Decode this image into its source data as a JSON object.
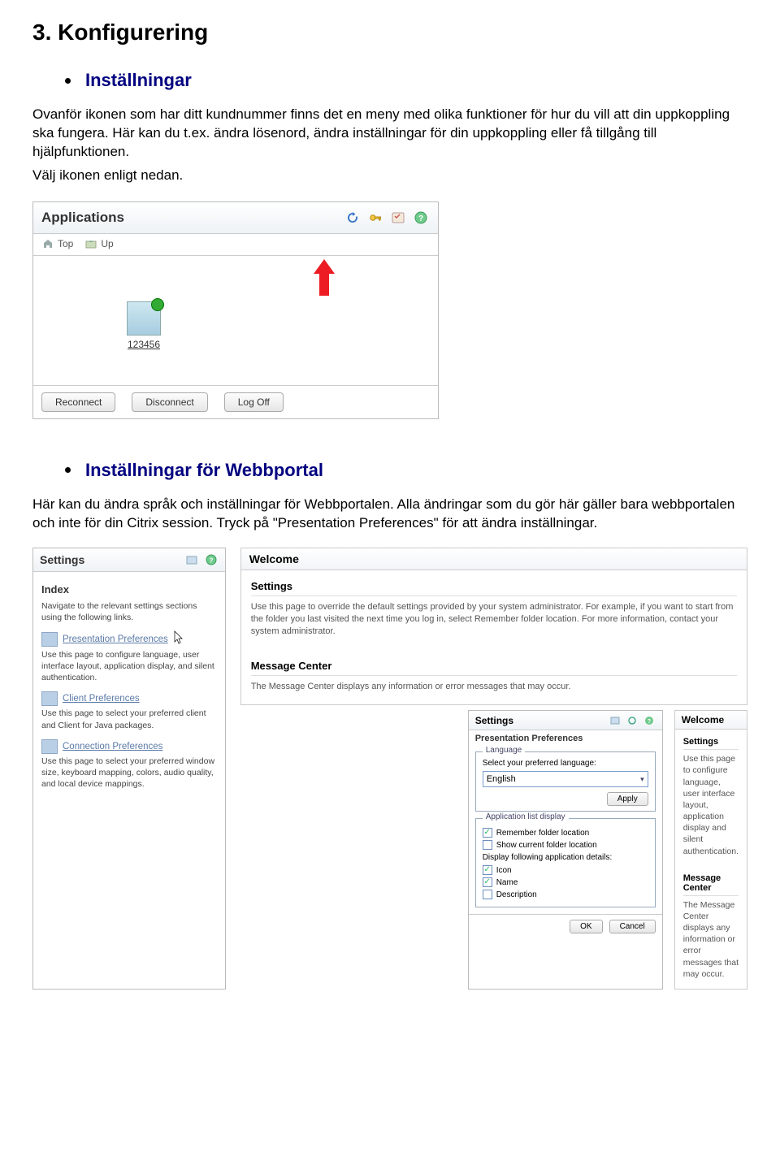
{
  "doc": {
    "heading": "3. Konfigurering",
    "bullet1": "Inställningar",
    "para1": "Ovanför ikonen som har ditt kundnummer finns det en meny med olika funktioner för hur du vill att din uppkoppling ska fungera. Här kan du t.ex. ändra lösenord, ändra inställningar för din uppkoppling eller få tillgång till hjälpfunktionen.",
    "para2": "Välj ikonen enligt nedan.",
    "bullet2": "Inställningar för Webbportal",
    "para3": "Här kan du ändra språk och inställningar för Webbportalen. Alla ändringar som du gör här gäller bara webbportalen och inte för din Citrix session. Tryck på \"Presentation Preferences\" för att ändra inställningar."
  },
  "apps": {
    "title": "Applications",
    "nav_top": "Top",
    "nav_up": "Up",
    "item_label": "123456",
    "btn_reconnect": "Reconnect",
    "btn_disconnect": "Disconnect",
    "btn_logoff": "Log Off"
  },
  "settings": {
    "title": "Settings",
    "index": "Index",
    "index_desc": "Navigate to the relevant settings sections using the following links.",
    "pres_link": "Presentation Preferences",
    "pres_desc": "Use this page to configure language, user interface layout, application display, and silent authentication.",
    "client_link": "Client Preferences",
    "client_desc": "Use this page to select your preferred client and Client for Java packages.",
    "conn_link": "Connection Preferences",
    "conn_desc": "Use this page to select your preferred window size, keyboard mapping, colors, audio quality, and local device mappings."
  },
  "welcome": {
    "title": "Welcome",
    "s_title": "Settings",
    "s_body": "Use this page to override the default settings provided by your system administrator. For example, if you want to start from the folder you last visited the next time you log in, select Remember folder location. For more information, contact your system administrator.",
    "m_title": "Message Center",
    "m_body": "The Message Center displays any information or error messages that may occur."
  },
  "prefs": {
    "title": "Settings",
    "sub": "Presentation Preferences",
    "lang_legend": "Language",
    "lang_label": "Select your preferred language:",
    "lang_value": "English",
    "apply": "Apply",
    "list_legend": "Application list display",
    "chk_remember": "Remember folder location",
    "chk_show": "Show current folder location",
    "list_label": "Display following application details:",
    "chk_icon": "Icon",
    "chk_name": "Name",
    "chk_desc": "Description",
    "ok": "OK",
    "cancel": "Cancel"
  },
  "mini": {
    "title": "Welcome",
    "s_title": "Settings",
    "s_body": "Use this page to configure language, user interface layout, application display and silent authentication.",
    "m_title": "Message Center",
    "m_body": "The Message Center displays any information or error messages that may occur."
  }
}
